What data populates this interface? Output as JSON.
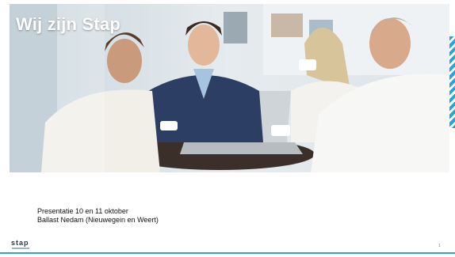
{
  "slide": {
    "title": "Wij zijn Stap",
    "subtitle_line1": "Presentatie  10 en 11 oktober",
    "subtitle_line2": "Ballast  Nedam  (Nieuwegein  en Weert)",
    "page_number": "1",
    "logo_text": "stap"
  },
  "colors": {
    "accent": "#2aa3d6",
    "logo": "#1a3a6b"
  }
}
